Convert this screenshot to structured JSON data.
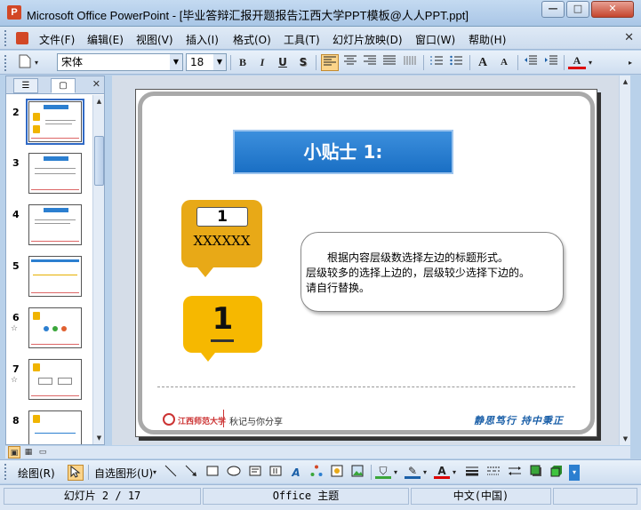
{
  "window": {
    "app_icon": "powerpoint-icon",
    "title": "Microsoft Office PowerPoint - [毕业答辩汇报开题报告江西大学PPT模板@人人PPT.ppt]",
    "minimize": "—",
    "maximize": "□",
    "close": "✕"
  },
  "menu": {
    "items": [
      "文件(F)",
      "编辑(E)",
      "视图(V)",
      "插入(I)",
      "格式(O)",
      "工具(T)",
      "幻灯片放映(D)",
      "窗口(W)",
      "帮助(H)"
    ],
    "close_glyph": "✕"
  },
  "format_toolbar": {
    "font_name": "宋体",
    "font_size": "18",
    "bold": "B",
    "italic": "I",
    "underline": "U",
    "shadow": "S",
    "grow_font": "A",
    "shrink_font": "A",
    "font_color": "A",
    "active_align": "align-left"
  },
  "slide_pane": {
    "tabs": [
      "outline-tab",
      "slides-tab"
    ],
    "close_glyph": "✕",
    "thumbnails": [
      {
        "number": "2",
        "selected": true,
        "star": ""
      },
      {
        "number": "3",
        "selected": false,
        "star": ""
      },
      {
        "number": "4",
        "selected": false,
        "star": ""
      },
      {
        "number": "5",
        "selected": false,
        "star": ""
      },
      {
        "number": "6",
        "selected": false,
        "star": "☆"
      },
      {
        "number": "7",
        "selected": false,
        "star": "☆"
      },
      {
        "number": "8",
        "selected": false,
        "star": ""
      }
    ]
  },
  "slide": {
    "title": "小贴士 1:",
    "callout1_number": "1",
    "callout1_label": "XXXXXX",
    "callout2_number": "1",
    "bubble_line1": "根据内容层级数选择左边的标题形式。",
    "bubble_line2": "层级较多的选择上边的，层级较少选择下边的。",
    "bubble_line3": "请自行替换。",
    "footer_school": "江西师范大学",
    "footer_left": "秋记与你分享",
    "footer_right": "静思笃行 持中秉正"
  },
  "draw_toolbar": {
    "draw_label": "绘图(R)",
    "autoshapes_label": "自选图形(U)"
  },
  "status": {
    "slide": "幻灯片 2 / 17",
    "theme": "Office 主题",
    "language": "中文(中国)"
  },
  "colors": {
    "title_bar": "#a9c6e6",
    "slide_title_fill": "#2478cf",
    "callout_orange": "#e8a917",
    "callout_yellow": "#f6b800",
    "footer_red": "#cc3333",
    "footer_blue": "#1a5fa8"
  }
}
